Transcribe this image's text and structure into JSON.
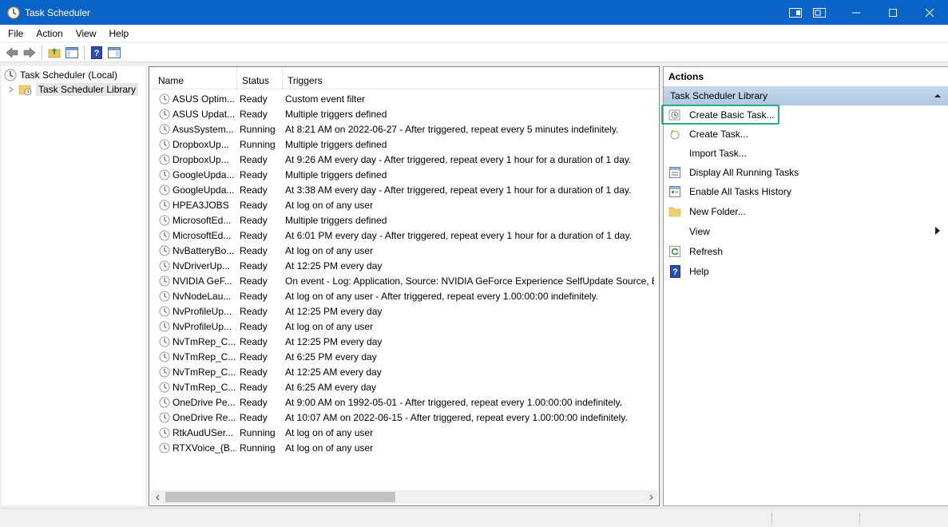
{
  "window": {
    "title": "Task Scheduler"
  },
  "menu": [
    "File",
    "Action",
    "View",
    "Help"
  ],
  "tree": {
    "root": "Task Scheduler (Local)",
    "child": "Task Scheduler Library"
  },
  "table": {
    "headers": {
      "name": "Name",
      "status": "Status",
      "triggers": "Triggers"
    },
    "rows": [
      {
        "name": "ASUS Optim...",
        "status": "Ready",
        "triggers": "Custom event filter"
      },
      {
        "name": "ASUS Updat...",
        "status": "Ready",
        "triggers": "Multiple triggers defined"
      },
      {
        "name": "AsusSystem...",
        "status": "Running",
        "triggers": "At 8:21 AM on 2022-06-27 - After triggered, repeat every 5 minutes indefinitely."
      },
      {
        "name": "DropboxUp...",
        "status": "Running",
        "triggers": "Multiple triggers defined"
      },
      {
        "name": "DropboxUp...",
        "status": "Ready",
        "triggers": "At 9:26 AM every day - After triggered, repeat every 1 hour for a duration of 1 day."
      },
      {
        "name": "GoogleUpda...",
        "status": "Ready",
        "triggers": "Multiple triggers defined"
      },
      {
        "name": "GoogleUpda...",
        "status": "Ready",
        "triggers": "At 3:38 AM every day - After triggered, repeat every 1 hour for a duration of 1 day."
      },
      {
        "name": "HPEA3JOBS",
        "status": "Ready",
        "triggers": "At log on of any user"
      },
      {
        "name": "MicrosoftEd...",
        "status": "Ready",
        "triggers": "Multiple triggers defined"
      },
      {
        "name": "MicrosoftEd...",
        "status": "Ready",
        "triggers": "At 6:01 PM every day - After triggered, repeat every 1 hour for a duration of 1 day."
      },
      {
        "name": "NvBatteryBo...",
        "status": "Ready",
        "triggers": "At log on of any user"
      },
      {
        "name": "NvDriverUp...",
        "status": "Ready",
        "triggers": "At 12:25 PM every day"
      },
      {
        "name": "NVIDIA GeF...",
        "status": "Ready",
        "triggers": "On event - Log: Application, Source: NVIDIA GeForce Experience SelfUpdate Source, Ever"
      },
      {
        "name": "NvNodeLau...",
        "status": "Ready",
        "triggers": "At log on of any user - After triggered, repeat every 1.00:00:00 indefinitely."
      },
      {
        "name": "NvProfileUp...",
        "status": "Ready",
        "triggers": "At 12:25 PM every day"
      },
      {
        "name": "NvProfileUp...",
        "status": "Ready",
        "triggers": "At log on of any user"
      },
      {
        "name": "NvTmRep_C...",
        "status": "Ready",
        "triggers": "At 12:25 PM every day"
      },
      {
        "name": "NvTmRep_C...",
        "status": "Ready",
        "triggers": "At 6:25 PM every day"
      },
      {
        "name": "NvTmRep_C...",
        "status": "Ready",
        "triggers": "At 12:25 AM every day"
      },
      {
        "name": "NvTmRep_C...",
        "status": "Ready",
        "triggers": "At 6:25 AM every day"
      },
      {
        "name": "OneDrive Pe...",
        "status": "Ready",
        "triggers": "At 9:00 AM on 1992-05-01 - After triggered, repeat every 1.00:00:00 indefinitely."
      },
      {
        "name": "OneDrive Re...",
        "status": "Ready",
        "triggers": "At 10:07 AM on 2022-06-15 - After triggered, repeat every 1.00:00:00 indefinitely."
      },
      {
        "name": "RtkAudUSer...",
        "status": "Running",
        "triggers": "At log on of any user"
      },
      {
        "name": "RTXVoice_{B...",
        "status": "Running",
        "triggers": "At log on of any user"
      }
    ]
  },
  "actions": {
    "title": "Actions",
    "section": "Task Scheduler Library",
    "items": [
      {
        "label": "Create Basic Task...",
        "icon": "create-basic-task-icon"
      },
      {
        "label": "Create Task...",
        "icon": "create-task-icon"
      },
      {
        "label": "Import Task...",
        "icon": ""
      },
      {
        "label": "Display All Running Tasks",
        "icon": "running-tasks-icon"
      },
      {
        "label": "Enable All Tasks History",
        "icon": "tasks-history-icon"
      },
      {
        "label": "New Folder...",
        "icon": "folder-icon"
      },
      {
        "label": "View",
        "icon": ""
      },
      {
        "label": "Refresh",
        "icon": "refresh-icon"
      },
      {
        "label": "Help",
        "icon": "help-icon"
      }
    ]
  },
  "colors": {
    "titlebar": "#0a64c8",
    "highlight": "#2bab84",
    "section": "#c6d9ec"
  }
}
